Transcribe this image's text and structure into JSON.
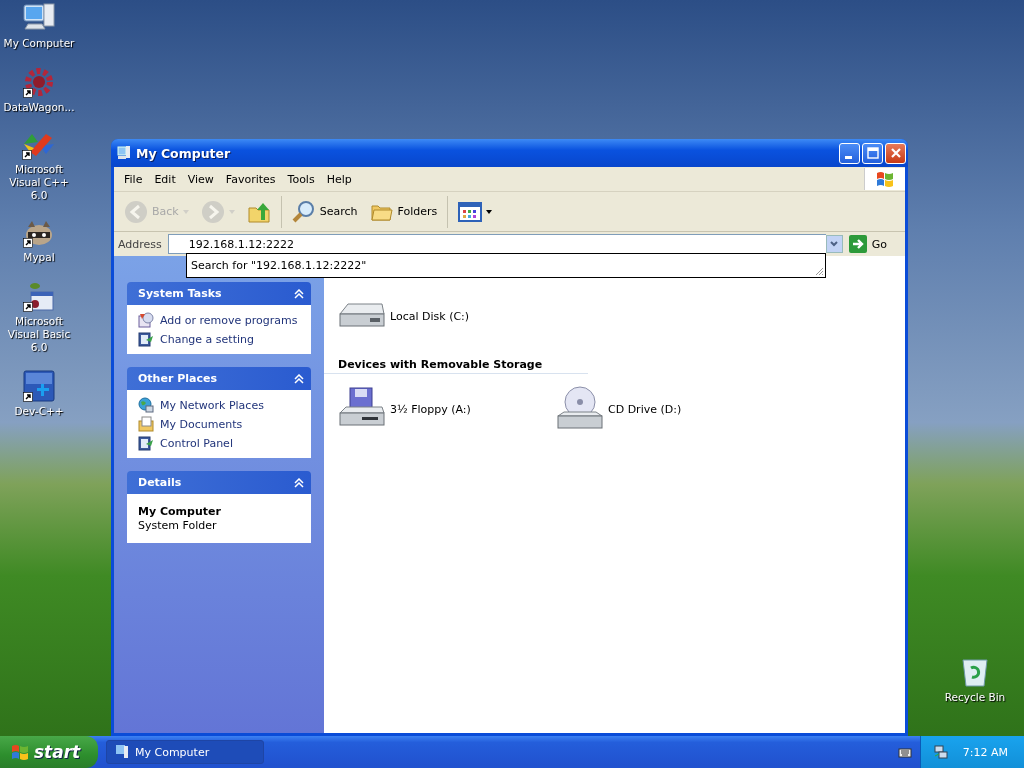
{
  "desktop_icons": [
    {
      "label": "My Computer",
      "kind": "computer",
      "shortcut": false
    },
    {
      "label": "DataWagon...",
      "kind": "gear",
      "shortcut": true
    },
    {
      "label": "Microsoft Visual C++ 6.0",
      "kind": "ribbon",
      "shortcut": true
    },
    {
      "label": "Mypal",
      "kind": "raccoon",
      "shortcut": true
    },
    {
      "label": "Microsoft Visual Basic 6.0",
      "kind": "vb",
      "shortcut": true
    },
    {
      "label": "Dev-C++",
      "kind": "tile",
      "shortcut": true
    }
  ],
  "recycle_bin": {
    "label": "Recycle Bin"
  },
  "window": {
    "title": "My Computer",
    "menu": [
      "File",
      "Edit",
      "View",
      "Favorites",
      "Tools",
      "Help"
    ],
    "toolbar": [
      {
        "kind": "back",
        "label": "Back",
        "disabled": true
      },
      {
        "kind": "forward",
        "disabled": true
      },
      {
        "kind": "up",
        "disabled": false
      },
      {
        "kind": "search",
        "label": "Search",
        "disabled": false
      },
      {
        "kind": "folders",
        "label": "Folders",
        "disabled": false
      },
      {
        "kind": "views",
        "disabled": false
      }
    ],
    "address": {
      "label": "Address",
      "value": "192.168.1.12:2222",
      "go": "Go"
    },
    "autocomplete": "Search for \"192.168.1.12:2222\"",
    "task_panels": [
      {
        "title": "System Tasks",
        "items": [
          {
            "label": "Add or remove programs",
            "kind": "programs"
          },
          {
            "label": "Change a setting",
            "kind": "panel"
          }
        ]
      },
      {
        "title": "Other Places",
        "items": [
          {
            "label": "My Network Places",
            "kind": "network"
          },
          {
            "label": "My Documents",
            "kind": "documents"
          },
          {
            "label": "Control Panel",
            "kind": "panel"
          }
        ]
      }
    ],
    "details": {
      "title": "Details",
      "name": "My Computer",
      "description": "System Folder"
    },
    "sections": [
      {
        "items": [
          {
            "label": "Local Disk (C:)",
            "kind": "disk"
          }
        ]
      },
      {
        "heading": "Devices with Removable Storage",
        "items": [
          {
            "label": "3½ Floppy (A:)",
            "kind": "floppy"
          },
          {
            "label": "CD Drive (D:)",
            "kind": "cd"
          }
        ]
      }
    ]
  },
  "taskbar": {
    "start": "start",
    "tasks": [
      {
        "label": "My Computer",
        "selected": true
      }
    ],
    "clock": "7:12 AM"
  }
}
